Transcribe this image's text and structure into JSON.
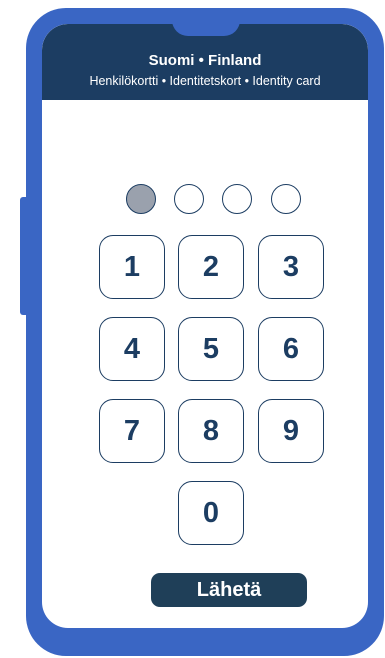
{
  "header": {
    "title": "Suomi • Finland",
    "subtitle": "Henkilökortti • Identitetskort • Identity card"
  },
  "pin": {
    "length": 4,
    "entered": 1
  },
  "keypad": {
    "keys": [
      "1",
      "2",
      "3",
      "4",
      "5",
      "6",
      "7",
      "8",
      "9",
      "0"
    ]
  },
  "submit": {
    "label": "Lähetä"
  },
  "colors": {
    "frame": "#3a66c4",
    "header": "#1c3d62",
    "key_border": "#1c3d62",
    "filled_dot": "#9aa1ad",
    "submit": "#1f3f58"
  }
}
